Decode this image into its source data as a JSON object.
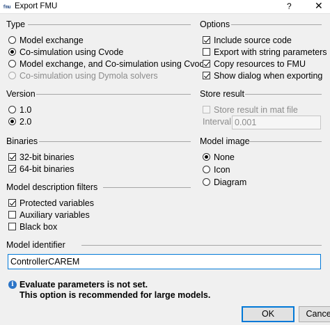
{
  "window": {
    "title": "Export FMU",
    "app_icon": "fmu",
    "help": "?",
    "close": "✕"
  },
  "type": {
    "title": "Type",
    "options": [
      {
        "label": "Model exchange",
        "checked": false,
        "enabled": true
      },
      {
        "label": "Co-simulation using Cvode",
        "checked": true,
        "enabled": true
      },
      {
        "label": "Model exchange, and Co-simulation using Cvode",
        "checked": false,
        "enabled": true
      },
      {
        "label": "Co-simulation using Dymola solvers",
        "checked": false,
        "enabled": false
      }
    ]
  },
  "options": {
    "title": "Options",
    "items": [
      {
        "label": "Include source code",
        "checked": true
      },
      {
        "label": "Export with string parameters",
        "checked": false
      },
      {
        "label": "Copy resources to FMU",
        "checked": true
      },
      {
        "label": "Show dialog when exporting",
        "checked": true
      }
    ]
  },
  "version": {
    "title": "Version",
    "options": [
      {
        "label": "1.0",
        "checked": false
      },
      {
        "label": "2.0",
        "checked": true
      }
    ]
  },
  "store_result": {
    "title": "Store result",
    "checkbox_label": "Store result in mat file",
    "checked": false,
    "interval_label": "Interval",
    "interval_value": "0.001"
  },
  "binaries": {
    "title": "Binaries",
    "items": [
      {
        "label": "32-bit binaries",
        "checked": true
      },
      {
        "label": "64-bit binaries",
        "checked": true
      }
    ]
  },
  "model_image": {
    "title": "Model image",
    "options": [
      {
        "label": "None",
        "checked": true
      },
      {
        "label": "Icon",
        "checked": false
      },
      {
        "label": "Diagram",
        "checked": false
      }
    ]
  },
  "filters": {
    "title": "Model description filters",
    "items": [
      {
        "label": "Protected variables",
        "checked": true
      },
      {
        "label": "Auxiliary variables",
        "checked": false
      },
      {
        "label": "Black box",
        "checked": false
      }
    ]
  },
  "identifier": {
    "title": "Model identifier",
    "value": "ControllerCAREM"
  },
  "info": {
    "line1": "Evaluate parameters is not set.",
    "line2": "This option is recommended for large models."
  },
  "buttons": {
    "ok": "OK",
    "cancel": "Cancel"
  },
  "colors": {
    "accent": "#0078d7",
    "info_icon": "#2b74c7"
  }
}
